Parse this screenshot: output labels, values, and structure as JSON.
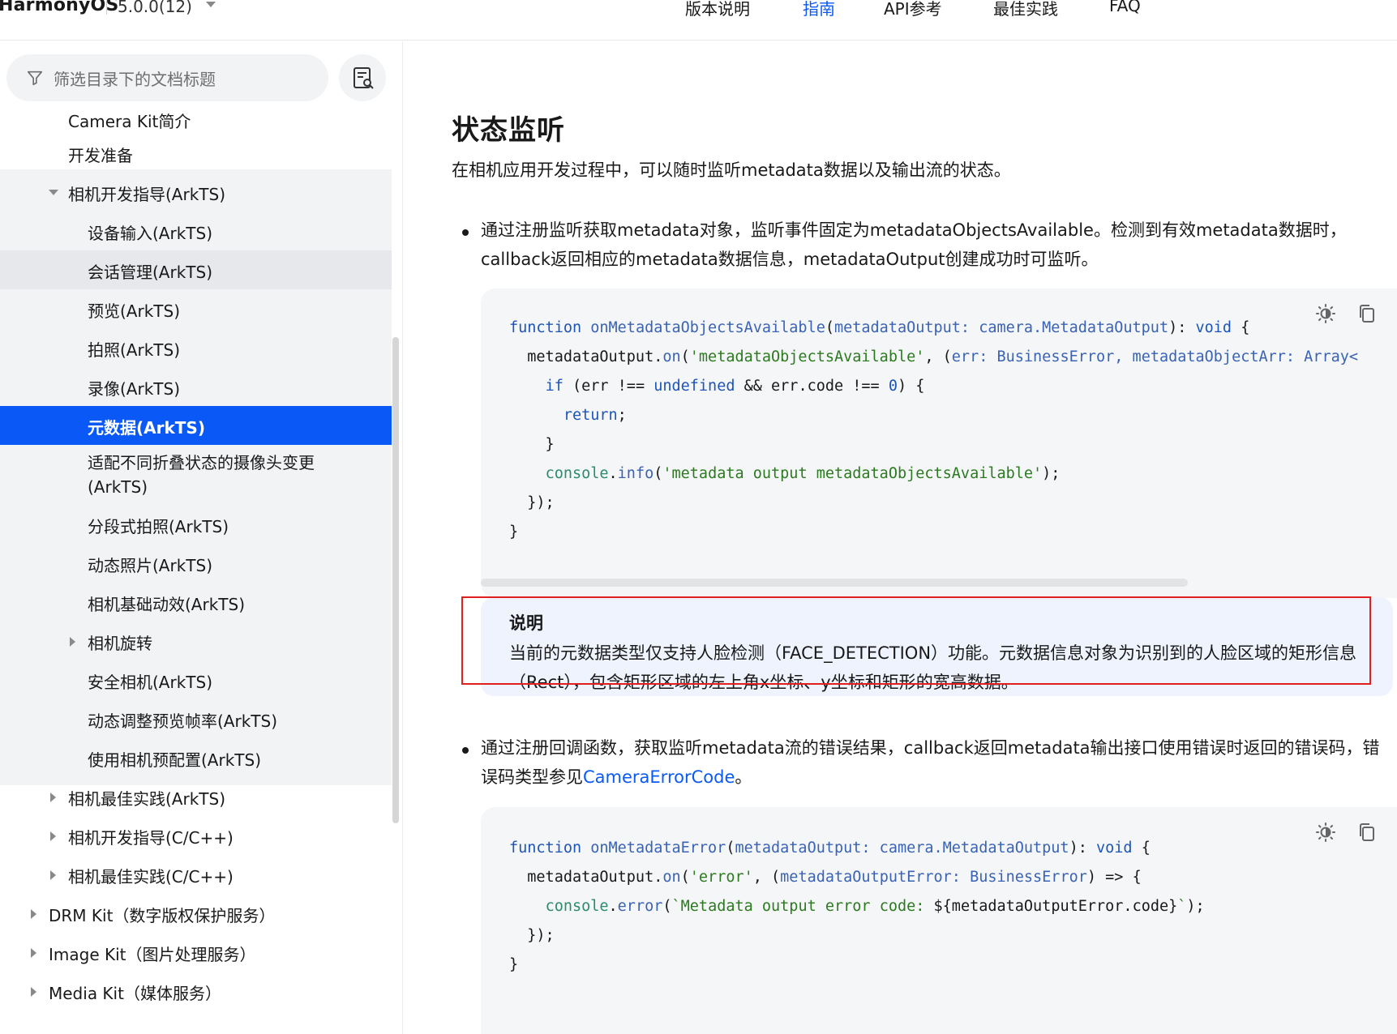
{
  "header": {
    "brand": "HarmonyOS",
    "version": "5.0.0(12)",
    "nav": [
      "版本说明",
      "指南",
      "API参考",
      "最佳实践",
      "FAQ"
    ],
    "active_nav": "指南"
  },
  "sidebar": {
    "filter_placeholder": "筛选目录下的文档标题",
    "items": [
      {
        "label": "Camera Kit简介",
        "level": 1
      },
      {
        "label": "开发准备",
        "level": 1
      },
      {
        "label": "相机开发指导(ArkTS)",
        "level": 1,
        "expanded": true
      },
      {
        "label": "设备输入(ArkTS)",
        "level": 2
      },
      {
        "label": "会话管理(ArkTS)",
        "level": 2,
        "hovered": true
      },
      {
        "label": "预览(ArkTS)",
        "level": 2
      },
      {
        "label": "拍照(ArkTS)",
        "level": 2
      },
      {
        "label": "录像(ArkTS)",
        "level": 2
      },
      {
        "label": "元数据(ArkTS)",
        "level": 2,
        "active": true
      },
      {
        "label": "适配不同折叠状态的摄像头变更(ArkTS)",
        "level": 2
      },
      {
        "label": "分段式拍照(ArkTS)",
        "level": 2
      },
      {
        "label": "动态照片(ArkTS)",
        "level": 2
      },
      {
        "label": "相机基础动效(ArkTS)",
        "level": 2
      },
      {
        "label": "相机旋转",
        "level": 2,
        "collapsed": true
      },
      {
        "label": "安全相机(ArkTS)",
        "level": 2
      },
      {
        "label": "动态调整预览帧率(ArkTS)",
        "level": 2
      },
      {
        "label": "使用相机预配置(ArkTS)",
        "level": 2
      },
      {
        "label": "相机最佳实践(ArkTS)",
        "level": 1,
        "collapsed": true
      },
      {
        "label": "相机开发指导(C/C++)",
        "level": 1,
        "collapsed": true
      },
      {
        "label": "相机最佳实践(C/C++)",
        "level": 1,
        "collapsed": true
      },
      {
        "label": "DRM Kit（数字版权保护服务）",
        "level": 0,
        "collapsed": true
      },
      {
        "label": "Image Kit（图片处理服务）",
        "level": 0,
        "collapsed": true
      },
      {
        "label": "Media Kit（媒体服务）",
        "level": 0,
        "collapsed": true
      }
    ]
  },
  "content": {
    "heading": "状态监听",
    "intro": "在相机应用开发过程中，可以随时监听metadata数据以及输出流的状态。",
    "bullet1": "通过注册监听获取metadata对象，监听事件固定为metadataObjectsAvailable。检测到有效metadata数据时，callback返回相应的metadata数据信息，metadataOutput创建成功时可监听。",
    "note_title": "说明",
    "note_text": "当前的元数据类型仅支持人脸检测（FACE_DETECTION）功能。元数据信息对象为识别到的人脸区域的矩形信息（Rect），包含矩形区域的左上角x坐标、y坐标和矩形的宽高数据。",
    "bullet2_prefix": "通过注册回调函数，获取监听metadata流的错误结果，callback返回metadata输出接口使用错误时返回的错误码，错误码类型参见",
    "bullet2_link": "CameraErrorCode",
    "bullet2_suffix": "。"
  },
  "code1": [
    "function onMetadataObjectsAvailable(metadataOutput: camera.MetadataOutput): void {",
    "  metadataOutput.on('metadataObjectsAvailable', (err: BusinessError, metadataObjectArr: Array<",
    "    if (err !== undefined && err.code !== 0) {",
    "      return;",
    "    }",
    "    console.info('metadata output metadataObjectsAvailable');",
    "  });",
    "}"
  ],
  "code2": [
    "function onMetadataError(metadataOutput: camera.MetadataOutput): void {",
    "  metadataOutput.on('error', (metadataOutputError: BusinessError) => {",
    "    console.error(`Metadata output error code: ${metadataOutputError.code}`);",
    "  });",
    "}"
  ],
  "colors": {
    "accent": "#0a59f7",
    "code_bg": "#f5f6f7",
    "note_bg": "#eef3fe",
    "highlight_frame": "#e02020"
  }
}
